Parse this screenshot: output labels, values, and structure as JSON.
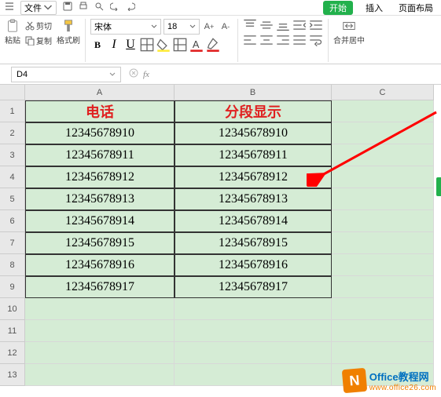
{
  "menubar": {
    "file": "文件",
    "tabs": {
      "start": "开始",
      "insert": "插入",
      "layout": "页面布局"
    }
  },
  "ribbon": {
    "clipboard": {
      "paste": "粘贴",
      "cut": "剪切",
      "copy": "复制",
      "format_painter": "格式刷"
    },
    "font": {
      "name": "宋体",
      "size": "18",
      "bold": "B",
      "italic": "I",
      "underline": "U"
    },
    "merge": "合并居中"
  },
  "namebox": "D4",
  "colhdrs": [
    "A",
    "B",
    "C"
  ],
  "rowhdrs": [
    "1",
    "2",
    "3",
    "4",
    "5",
    "6",
    "7",
    "8",
    "9",
    "10",
    "11",
    "12",
    "13"
  ],
  "headers": {
    "a": "电话",
    "b": "分段显示"
  },
  "rows": [
    {
      "a": "12345678910",
      "b": "12345678910"
    },
    {
      "a": "12345678911",
      "b": "12345678911"
    },
    {
      "a": "12345678912",
      "b": "12345678912"
    },
    {
      "a": "12345678913",
      "b": "12345678913"
    },
    {
      "a": "12345678914",
      "b": "12345678914"
    },
    {
      "a": "12345678915",
      "b": "12345678915"
    },
    {
      "a": "12345678916",
      "b": "12345678916"
    },
    {
      "a": "12345678917",
      "b": "12345678917"
    }
  ],
  "watermark": {
    "logo": "N",
    "line1": "Office教程网",
    "line2": "www.office26.com"
  }
}
